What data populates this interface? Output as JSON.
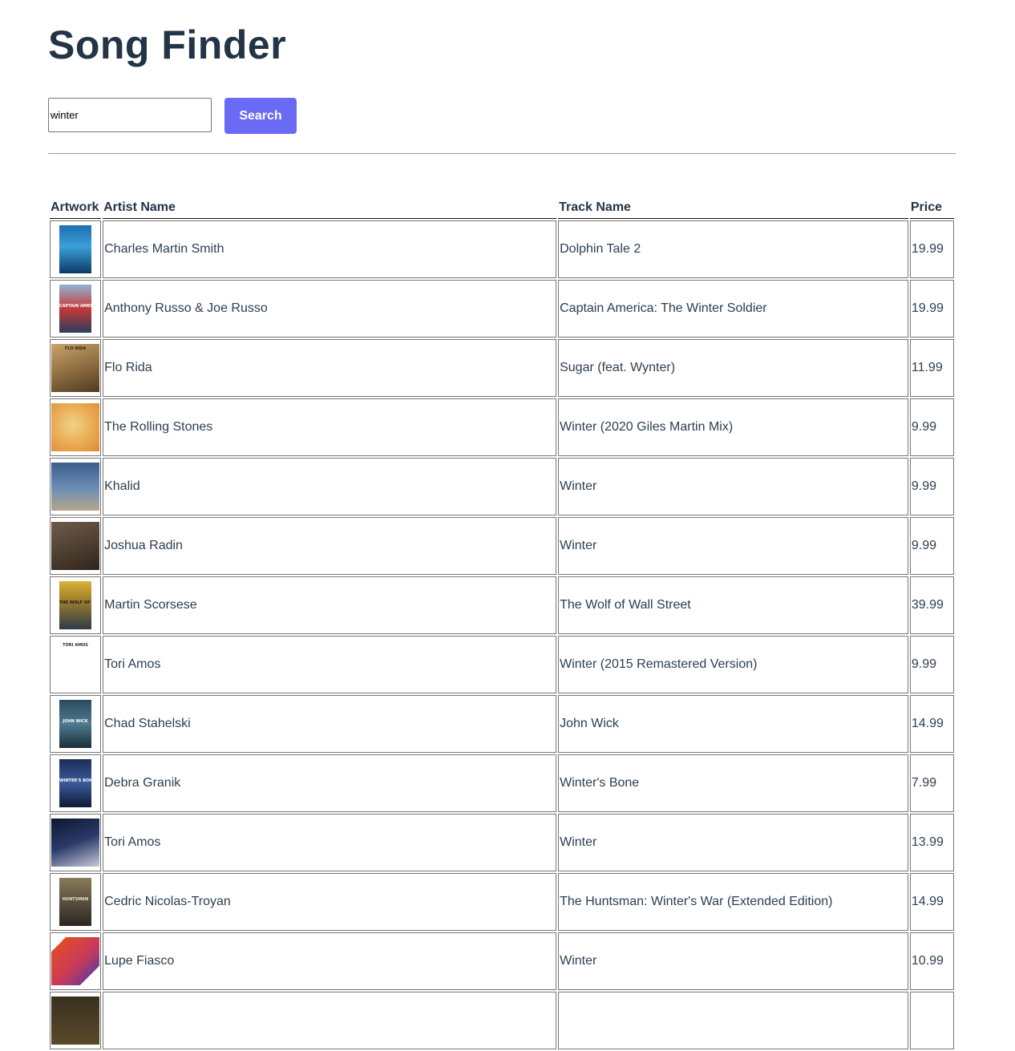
{
  "header": {
    "title": "Song Finder"
  },
  "search": {
    "value": "winter",
    "button_label": "Search"
  },
  "table": {
    "columns": [
      "Artwork",
      "Artist Name",
      "Track Name",
      "Price"
    ],
    "rows": [
      {
        "artist": "Charles Martin Smith",
        "track": "Dolphin Tale 2",
        "price": "19.99",
        "art": {
          "shape": "poster",
          "bg": "linear-gradient(180deg,#1e6fb0 0%,#3aa0d8 45%,#0d3a66 100%)",
          "text": "",
          "fg": "#ffffff"
        }
      },
      {
        "artist": "Anthony Russo & Joe Russo",
        "track": "Captain America: The Winter Soldier",
        "price": "19.99",
        "art": {
          "shape": "poster",
          "bg": "linear-gradient(180deg,#8fb4d6 0%,#c53a35 50%,#2a3d5e 100%)",
          "text": "CAPTAIN AMERICA",
          "fg": "#ffffff"
        }
      },
      {
        "artist": "Flo Rida",
        "track": "Sugar (feat. Wynter)",
        "price": "11.99",
        "art": {
          "shape": "album",
          "bg": "linear-gradient(160deg,#c9a46a 0%,#8a6a3d 55%,#4e3a22 100%)",
          "text": "FLO RIDA",
          "fg": "#2a1f12"
        }
      },
      {
        "artist": "The Rolling Stones",
        "track": "Winter (2020 Giles Martin Mix)",
        "price": "9.99",
        "art": {
          "shape": "album",
          "bg": "radial-gradient(circle at 45% 45%,#f2d28a 0%,#e8a64c 60%,#d98a3a 100%)",
          "text": "",
          "fg": "#5a3a10"
        }
      },
      {
        "artist": "Khalid",
        "track": "Winter",
        "price": "9.99",
        "art": {
          "shape": "album",
          "bg": "linear-gradient(180deg,#3a5e8c 0%,#6d8fb5 55%,#b7a58c 100%)",
          "text": "",
          "fg": "#ffffff"
        }
      },
      {
        "artist": "Joshua Radin",
        "track": "Winter",
        "price": "9.99",
        "art": {
          "shape": "album",
          "bg": "linear-gradient(160deg,#6e5c4a 0%,#4a3b2e 60%,#2e241b 100%)",
          "text": "",
          "fg": "#d8c7b0"
        }
      },
      {
        "artist": "Martin Scorsese",
        "track": "The Wolf of Wall Street",
        "price": "39.99",
        "art": {
          "shape": "poster",
          "bg": "linear-gradient(180deg,#d8b23a 0%,#b08a2a 30%,#2f3a48 100%)",
          "text": "THE WOLF OF WALL STREET",
          "fg": "#1a1a1a"
        }
      },
      {
        "artist": "Tori Amos",
        "track": "Winter (2015 Remastered Version)",
        "price": "9.99",
        "art": {
          "shape": "album",
          "bg": "linear-gradient(180deg,#ffffff 0%,#ffffff 100%)",
          "text": "TORI AMOS",
          "fg": "#3a2a1a"
        }
      },
      {
        "artist": "Chad Stahelski",
        "track": "John Wick",
        "price": "14.99",
        "art": {
          "shape": "poster",
          "bg": "linear-gradient(180deg,#2b4a5e 0%,#4f7a90 50%,#1b2e3a 100%)",
          "text": "JOHN WICK",
          "fg": "#ffffff"
        }
      },
      {
        "artist": "Debra Granik",
        "track": "Winter's Bone",
        "price": "7.99",
        "art": {
          "shape": "poster",
          "bg": "linear-gradient(180deg,#1d2d5a 0%,#3a5a9a 50%,#0f1a36 100%)",
          "text": "WINTER'S BONE",
          "fg": "#ffffff"
        }
      },
      {
        "artist": "Tori Amos",
        "track": "Winter",
        "price": "13.99",
        "art": {
          "shape": "album",
          "bg": "linear-gradient(160deg,#0e1630 0%,#2a3a6a 50%,#c8c8d8 100%)",
          "text": "",
          "fg": "#ffffff"
        }
      },
      {
        "artist": "Cedric Nicolas-Troyan",
        "track": "The Huntsman: Winter's War (Extended Edition)",
        "price": "14.99",
        "art": {
          "shape": "poster",
          "bg": "linear-gradient(180deg,#8a7a5a 0%,#5a5040 50%,#2a2620 100%)",
          "text": "HUNTSMAN",
          "fg": "#f0e6c8"
        }
      },
      {
        "artist": "Lupe Fiasco",
        "track": "Winter",
        "price": "10.99",
        "art": {
          "shape": "album",
          "bg": "linear-gradient(135deg,#ffffff 0%,#ffffff 15%,#e04a2a 15%,#c83a5a 55%,#7a3a8a 80%,#ffffff 80%)",
          "text": "",
          "fg": "#ffffff"
        }
      },
      {
        "artist": "",
        "track": "",
        "price": "",
        "art": {
          "shape": "album",
          "bg": "linear-gradient(180deg,#3a3020 0%,#5a4a2a 100%)",
          "text": "",
          "fg": "#ffffff"
        }
      }
    ]
  }
}
